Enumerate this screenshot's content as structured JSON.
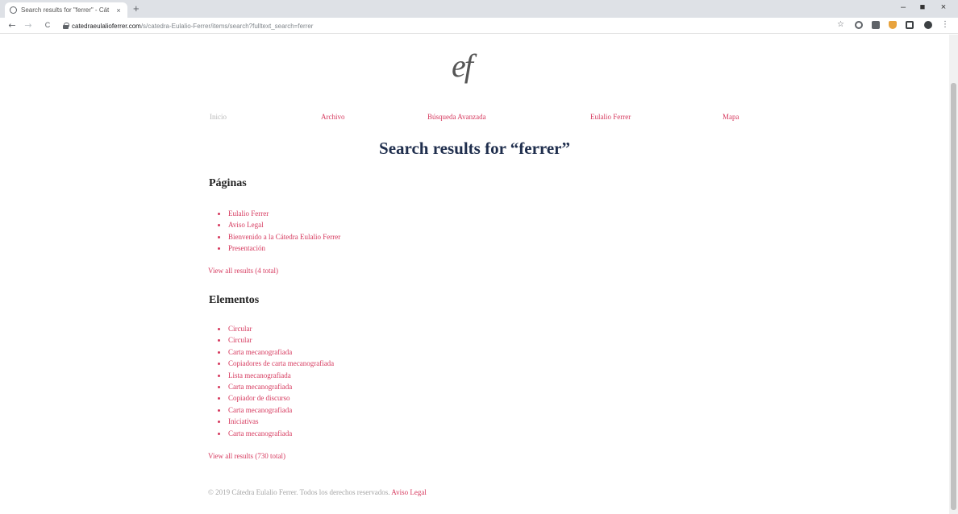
{
  "browser": {
    "tab_title": "Search results for \"ferrer\" - Cát",
    "tab_close": "×",
    "new_tab": "+",
    "url_domain": "catedraeulalioferrer.com",
    "url_path": "/s/catedra-Eulalio-Ferrer/items/search?fulltext_search=ferrer",
    "back": "←",
    "forward": "→",
    "reload": "C",
    "minimize": "–",
    "maximize": "■",
    "close": "×",
    "star": "☆",
    "menu": "⋮"
  },
  "logo": "ef",
  "nav": {
    "items": [
      {
        "label": "Inicio",
        "active": false
      },
      {
        "label": "Archivo",
        "active": true
      },
      {
        "label": "Búsqueda Avanzada",
        "active": true
      },
      {
        "label": "Eulalio Ferrer",
        "active": true
      },
      {
        "label": "Mapa",
        "active": true
      }
    ]
  },
  "page_title": "Search results for “ferrer”",
  "paginas": {
    "title": "Páginas",
    "results": [
      "Eulalio Ferrer",
      "Aviso Legal",
      "Bienvenido a la Cátedra Eulalio Ferrer",
      "Presentación"
    ],
    "view_all": "View all results (4 total)"
  },
  "elementos": {
    "title": "Elementos",
    "results": [
      "Circular",
      "Circular",
      "Carta mecanografiada",
      "Copiadores de carta mecanografiada",
      "Lista mecanografiada",
      "Carta mecanografiada",
      "Copiador de discurso",
      "Carta mecanografiada",
      "Iniciativas",
      "Carta mecanografiada"
    ],
    "view_all": "View all results (730 total)"
  },
  "footer": {
    "text": "© 2019 Cátedra Eulalio Ferrer. Todos los derechos reservados.",
    "link": "Aviso Legal"
  }
}
